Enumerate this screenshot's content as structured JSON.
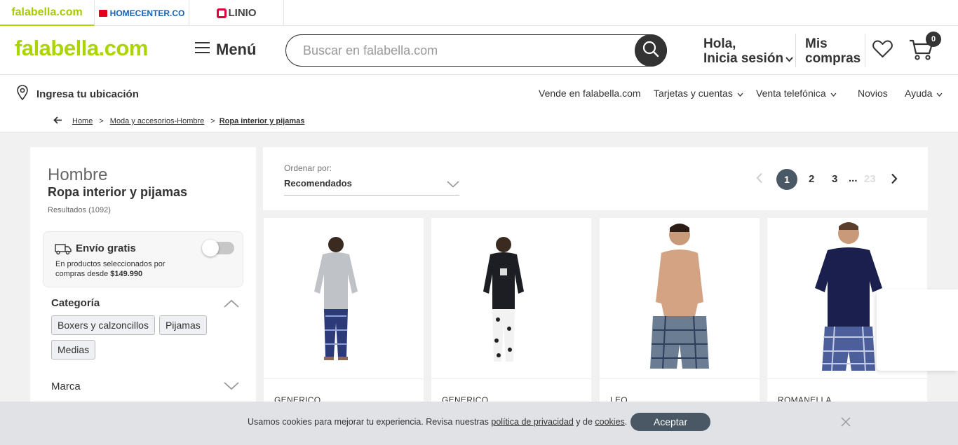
{
  "brand_tabs": [
    {
      "label": "falabella.com",
      "active": true
    },
    {
      "label": "HOMECENTER.CO",
      "active": false
    },
    {
      "label": "LINIO",
      "active": false
    }
  ],
  "header": {
    "logo": "falabella.com",
    "menu_label": "Menú",
    "search_placeholder": "Buscar en falabella.com",
    "greeting_line1": "Hola,",
    "greeting_line2": "Inicia sesión",
    "orders_line1": "Mis",
    "orders_line2": "compras",
    "cart_count": "0"
  },
  "subnav": {
    "location": "Ingresa tu ubicación",
    "links": [
      "Vende en falabella.com",
      "Tarjetas y cuentas",
      "Venta telefónica",
      "Novios",
      "Ayuda"
    ]
  },
  "breadcrumb": {
    "items": [
      "Home",
      "Moda y accesorios-Hombre",
      "Ropa interior y pijamas"
    ],
    "separator": ">"
  },
  "sidebar": {
    "title": "Hombre",
    "subtitle": "Ropa interior y pijamas",
    "results": "Resultados (1092)",
    "envio_title": "Envío gratis",
    "envio_desc": "En productos seleccionados por compras desde",
    "envio_amount": "$149.990",
    "category_title": "Categoría",
    "categories": [
      "Boxers y calzoncillos",
      "Pijamas",
      "Medias"
    ],
    "brand_title": "Marca"
  },
  "sort": {
    "label": "Ordenar por:",
    "value": "Recomendados"
  },
  "pagination": {
    "current": "1",
    "pages": [
      "2",
      "3"
    ],
    "ellipsis": "...",
    "last": "23"
  },
  "products": [
    {
      "brand": "GENERICO"
    },
    {
      "brand": "GENERICO"
    },
    {
      "brand": "LEO"
    },
    {
      "brand": "ROMANELLA"
    }
  ],
  "cookie": {
    "text_before": "Usamos cookies para mejorar tu experiencia. Revisa nuestras ",
    "privacy_link": "política de privacidad",
    "text_middle": " y de ",
    "cookies_link": "cookies",
    "text_after": ".",
    "accept_label": "Aceptar"
  },
  "colors": {
    "brand_green": "#aad500",
    "dark": "#333333",
    "pager_active": "#4a5866"
  }
}
